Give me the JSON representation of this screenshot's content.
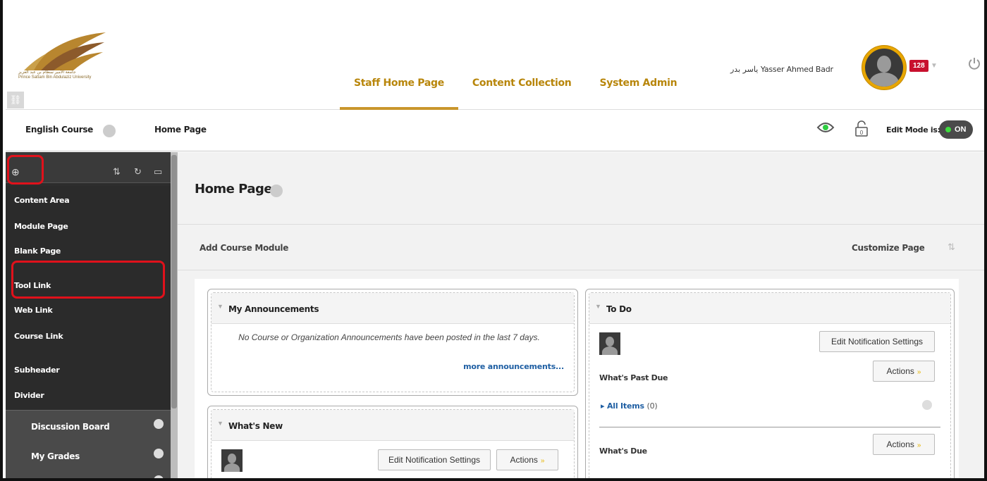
{
  "header": {
    "logo_text": "جامعة الأمير سطام بن عبد العزيز\nPrince Sattam Bin Abdulaziz University",
    "nav_tabs": [
      {
        "label": "Staff Home Page",
        "active": true
      },
      {
        "label": "Content Collection",
        "active": false
      },
      {
        "label": "System Admin",
        "active": false
      }
    ],
    "user_name": "ياسر بدر Yasser Ahmed Badr",
    "notification_count": "128"
  },
  "breadcrumb": {
    "course": "English Course",
    "page": "Home Page"
  },
  "edit_mode": {
    "label": "Edit Mode is:",
    "state": "ON",
    "lock_count": "0"
  },
  "sidebar": {
    "add_menu_items": [
      "Content Area",
      "Module Page",
      "Blank Page",
      "Tool Link",
      "Web Link",
      "Course Link",
      "Subheader",
      "Divider"
    ],
    "course_menu": [
      "Discussion Board",
      "My Grades"
    ]
  },
  "main": {
    "page_title": "Home Page",
    "add_module": "Add Course Module",
    "customize": "Customize Page",
    "announcements": {
      "title": "My Announcements",
      "message": "No Course or Organization Announcements have been posted in the last 7 days.",
      "more_link": "more announcements..."
    },
    "whats_new": {
      "title": "What's New",
      "edit_btn": "Edit Notification Settings",
      "actions_btn": "Actions"
    },
    "todo": {
      "title": "To Do",
      "edit_btn": "Edit Notification Settings",
      "actions_btn": "Actions",
      "past_due": "What's Past Due",
      "all_items": "All Items",
      "all_items_count": "(0)",
      "due": "What's Due",
      "actions_btn_2": "Actions"
    }
  },
  "colors": {
    "accent_gold": "#b8860b",
    "sidebar_dark": "#2d2d2d",
    "highlight_red": "#e0111b",
    "badge_red": "#c8102e",
    "link_blue": "#1f5fa3"
  }
}
